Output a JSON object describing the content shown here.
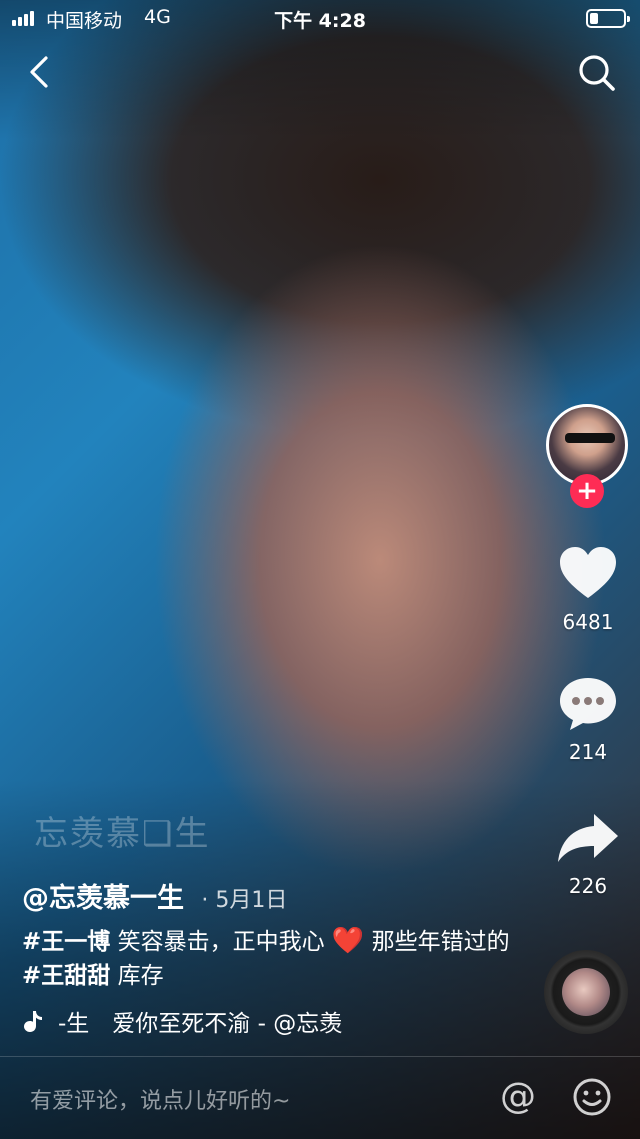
{
  "status_bar": {
    "carrier": "中国移动",
    "network": "4G",
    "time": "下午 4:28",
    "battery_level": 0.25
  },
  "nav": {
    "back_icon": "chevron-left-icon",
    "search_icon": "search-icon"
  },
  "rail": {
    "follow_label": "+",
    "likes": "6481",
    "comments": "214",
    "shares": "226"
  },
  "watermark": "忘羡慕❑生",
  "post": {
    "author": "@忘羡慕一生",
    "separator": "·",
    "date": "5月1日",
    "caption_tag1": "#王一博",
    "caption_text1": " 笑容暴击，正中我心 ",
    "caption_heart": "❤️",
    "caption_text2": " 那些年错过的",
    "caption_tag2": "#王甜甜",
    "caption_text3": " 库存",
    "music": "-生　爱你至死不渝 - @忘羡"
  },
  "comment_bar": {
    "placeholder": "有爱评论，说点儿好听的~",
    "at_label": "@"
  },
  "colors": {
    "accent": "#fe2c55",
    "text": "#ffffff"
  }
}
